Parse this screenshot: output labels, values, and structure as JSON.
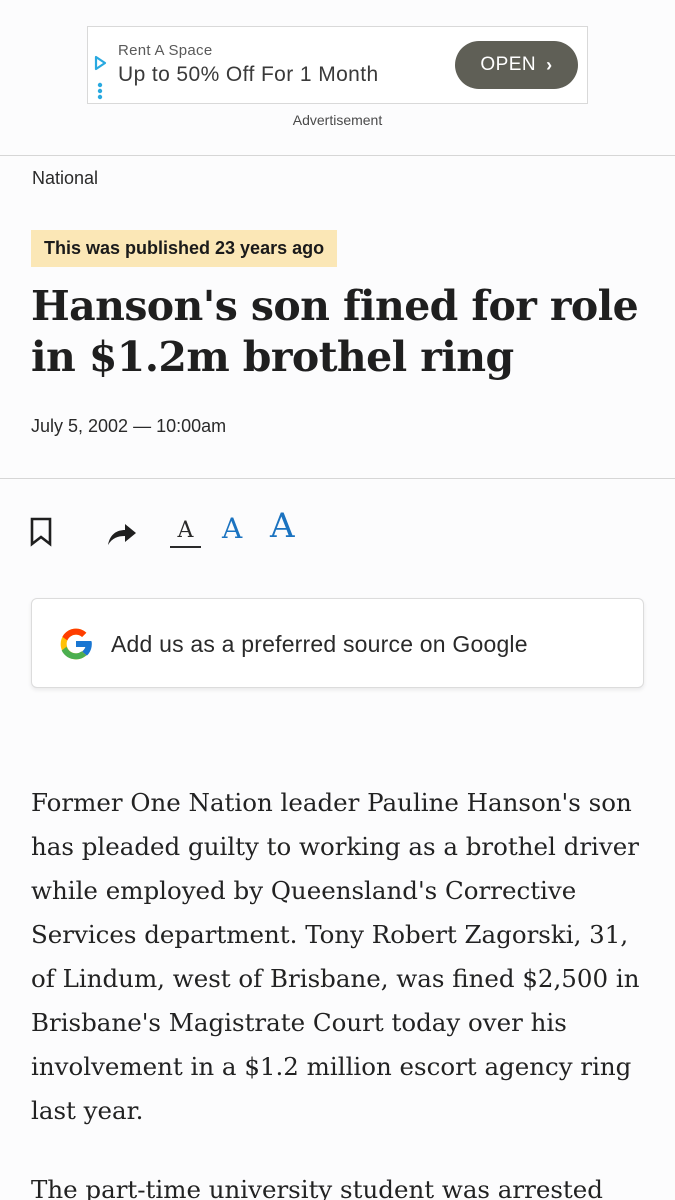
{
  "ad": {
    "sponsor": "Rent A Space",
    "headline": "Up to 50% Off For 1 Month",
    "cta_label": "OPEN",
    "label": "Advertisement"
  },
  "article": {
    "section": "National",
    "age_notice": "This was published 23 years ago",
    "headline": "Hanson's son fined for role in $1.2m brothel ring",
    "dateline": "July 5, 2002 — 10:00am"
  },
  "toolbar": {
    "font_size_labels": [
      "A",
      "A",
      "A"
    ],
    "icons": [
      "bookmark-icon",
      "share-icon"
    ],
    "accent_color": "#1b73c0"
  },
  "google_card": {
    "label": "Add us as a preferred source on Google"
  },
  "body": {
    "paragraphs": [
      "Former One Nation leader Pauline Hanson's son has pleaded guilty to working as a brothel driver while employed by Queensland's Corrective Services department. Tony Robert Zagorski, 31, of Lindum, west of Brisbane, was fined $2,500 in Brisbane's Magistrate Court today over his involvement in a $1.2 million escort agency ring last year.",
      "The part-time university student was arrested after"
    ]
  }
}
